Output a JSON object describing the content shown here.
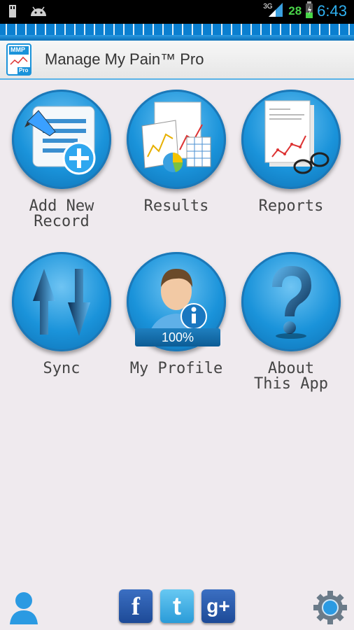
{
  "status_bar": {
    "network": "3G",
    "battery_level": "28",
    "time": "6:43",
    "icons": [
      "sd-card-icon",
      "android-icon",
      "signal-icon",
      "battery-icon"
    ]
  },
  "app": {
    "title": "Manage My Pain™ Pro",
    "logo_text": "MMP",
    "logo_badge": "Pro"
  },
  "tiles": [
    {
      "id": "add-new-record",
      "line1": "Add New",
      "line2": "Record",
      "icon": "add-record-icon"
    },
    {
      "id": "results",
      "line1": "Results",
      "line2": "",
      "icon": "results-charts-icon"
    },
    {
      "id": "reports",
      "line1": "Reports",
      "line2": "",
      "icon": "report-icon"
    },
    {
      "id": "sync",
      "line1": "Sync",
      "line2": "",
      "icon": "sync-arrows-icon"
    },
    {
      "id": "my-profile",
      "line1": "My Profile",
      "line2": "",
      "icon": "profile-icon",
      "profile_completion": "100%"
    },
    {
      "id": "about",
      "line1": "About",
      "line2": "This App",
      "icon": "question-mark-icon"
    }
  ],
  "bottom_bar": {
    "facebook": "f",
    "twitter": "t",
    "google_plus": "g+",
    "icons": [
      "user-icon",
      "facebook-icon",
      "twitter-icon",
      "google-plus-icon",
      "settings-gear-icon"
    ]
  },
  "colors": {
    "primary_blue": "#1a93da",
    "status_time": "#2fb0f0",
    "battery_green": "#49d449",
    "background": "#efeaee"
  }
}
